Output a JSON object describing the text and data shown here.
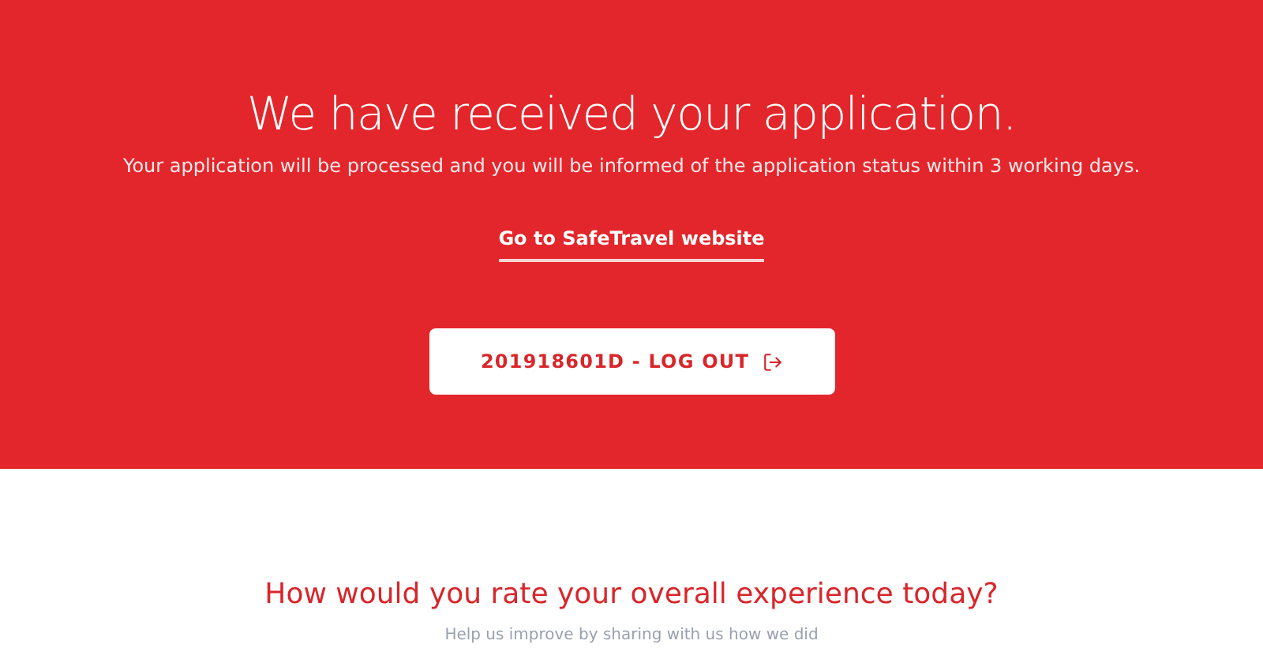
{
  "confirmation": {
    "title": "We have received your application.",
    "message": "Your application will be processed and you will be informed of the application status within 3 working days.",
    "link": "Go to SafeTravel website",
    "logout_button": "201918601D - LOG OUT"
  },
  "feedback": {
    "title": "How would you rate your overall experience today?",
    "subtitle": "Help us improve by sharing with us how we did"
  }
}
